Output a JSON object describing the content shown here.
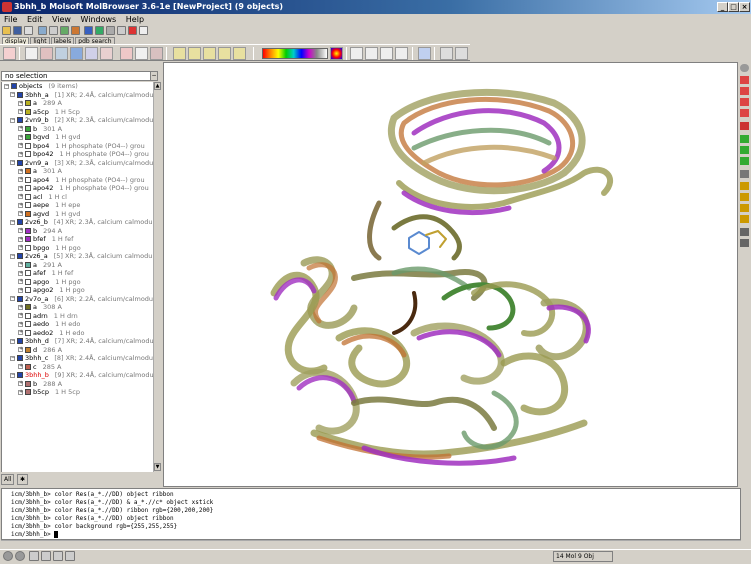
{
  "window": {
    "title": "3bhh_b Molsoft MolBrowser 3.6-1e  [NewProject]  (9 objects)"
  },
  "menu": [
    "File",
    "Edit",
    "View",
    "Windows",
    "Help"
  ],
  "toolbar_tabs": [
    "display",
    "light",
    "labels",
    "pdb search"
  ],
  "selection_label": "no selection",
  "tree": {
    "root": {
      "name": "objects",
      "desc": "(9 items)"
    },
    "rows": [
      {
        "level": 1,
        "name": "3bhh_a",
        "desc": "[1] XR; 2.4Å, calcium/calmodu",
        "chip": "#2244aa",
        "red": false
      },
      {
        "level": 2,
        "name": "a",
        "desc": "289 A",
        "chip": "#b8b020",
        "red": false
      },
      {
        "level": 2,
        "name": "a5cp",
        "desc": "1 H   5cp",
        "chip": "#b8b020",
        "red": false
      },
      {
        "level": 1,
        "name": "2vn9_b",
        "desc": "[2] XR; 2.3Å, calcium/calmodu",
        "chip": "#2244aa",
        "red": false
      },
      {
        "level": 2,
        "name": "b",
        "desc": "301 A",
        "chip": "#3aa63a",
        "red": false
      },
      {
        "level": 2,
        "name": "bgvd",
        "desc": "1 H   gvd",
        "chip": "#3aa63a",
        "red": false
      },
      {
        "level": 2,
        "name": "bpo4",
        "desc": "1 H   phosphate (PO4--) grou",
        "chip": "",
        "red": false
      },
      {
        "level": 2,
        "name": "bpo42",
        "desc": "1 H   phosphate (PO4--) grou",
        "chip": "",
        "red": false
      },
      {
        "level": 1,
        "name": "2vn9_a",
        "desc": "[3] XR; 2.3Å, calcium/calmodu",
        "chip": "#2244aa",
        "red": false
      },
      {
        "level": 2,
        "name": "a",
        "desc": "301 A",
        "chip": "#d07020",
        "red": false
      },
      {
        "level": 2,
        "name": "apo4",
        "desc": "1 H   phosphate (PO4--) grou",
        "chip": "",
        "red": false
      },
      {
        "level": 2,
        "name": "apo42",
        "desc": "1 H   phosphate (PO4--) grou",
        "chip": "",
        "red": false
      },
      {
        "level": 2,
        "name": "acl",
        "desc": "1 H   cl",
        "chip": "",
        "red": false
      },
      {
        "level": 2,
        "name": "aepe",
        "desc": "1 H   epe",
        "chip": "",
        "red": false
      },
      {
        "level": 2,
        "name": "agvd",
        "desc": "1 H   gvd",
        "chip": "#d07020",
        "red": false
      },
      {
        "level": 1,
        "name": "2vz6_b",
        "desc": "[4] XR; 2.3Å, calcium calmodu",
        "chip": "#2244aa",
        "red": false
      },
      {
        "level": 2,
        "name": "b",
        "desc": "294 A",
        "chip": "#a030c0",
        "red": false
      },
      {
        "level": 2,
        "name": "bfef",
        "desc": "1 H   fef",
        "chip": "#a030c0",
        "red": false
      },
      {
        "level": 2,
        "name": "bpgo",
        "desc": "1 H   pgo",
        "chip": "",
        "red": false
      },
      {
        "level": 1,
        "name": "2vz6_a",
        "desc": "[5] XR; 2.3Å, calcium calmodu",
        "chip": "#2244aa",
        "red": false
      },
      {
        "level": 2,
        "name": "a",
        "desc": "291 A",
        "chip": "#60b0a0",
        "red": false
      },
      {
        "level": 2,
        "name": "afef",
        "desc": "1 H   fef",
        "chip": "",
        "red": false
      },
      {
        "level": 2,
        "name": "apgo",
        "desc": "1 H   pgo",
        "chip": "",
        "red": false
      },
      {
        "level": 2,
        "name": "apgo2",
        "desc": "1 H   pgo",
        "chip": "",
        "red": false
      },
      {
        "level": 1,
        "name": "2v7o_a",
        "desc": "[6] XR; 2.2Å, calcium/calmodu",
        "chip": "#2244aa",
        "red": false
      },
      {
        "level": 2,
        "name": "a",
        "desc": "308 A",
        "chip": "#707020",
        "red": false
      },
      {
        "level": 2,
        "name": "adrn",
        "desc": "1 H   drn",
        "chip": "",
        "red": false
      },
      {
        "level": 2,
        "name": "aedo",
        "desc": "1 H   edo",
        "chip": "",
        "red": false
      },
      {
        "level": 2,
        "name": "aedo2",
        "desc": "1 H   edo",
        "chip": "",
        "red": false
      },
      {
        "level": 1,
        "name": "3bhh_d",
        "desc": "[7] XR; 2.4Å, calcium/calmodu",
        "chip": "#2244aa",
        "red": false
      },
      {
        "level": 2,
        "name": "d",
        "desc": "286 A",
        "chip": "#c08030",
        "red": false
      },
      {
        "level": 1,
        "name": "3bhh_c",
        "desc": "[8] XR; 2.4Å, calcium/calmodu",
        "chip": "#2244aa",
        "red": false
      },
      {
        "level": 2,
        "name": "c",
        "desc": "285 A",
        "chip": "#c06050",
        "red": false
      },
      {
        "level": 1,
        "name": "3bhh_b",
        "desc": "[9] XR; 2.4Å, calcium/calmodu",
        "chip": "#2244aa",
        "red": true
      },
      {
        "level": 2,
        "name": "b",
        "desc": "288 A",
        "chip": "#b07070",
        "red": false
      },
      {
        "level": 2,
        "name": "b5cp",
        "desc": "1 H   5cp",
        "chip": "#b07070",
        "red": false
      }
    ]
  },
  "left_tabs": [
    "All",
    "icon"
  ],
  "terminal": {
    "lines": [
      "icm/3bhh_b> color Res(a_*.//DD) object ribbon",
      "icm/3bhh_b> color Res(a_*.//DD) & a_*.//c* object xstick",
      "icm/3bhh_b> color Res(a_*.//DD) ribbon rgb={200,200,200}",
      "icm/3bhh_b> color Res(a_*.//DD) object ribbon",
      "icm/3bhh_b> color background rgb={255,255,255}",
      "icm/3bhh_b> "
    ]
  },
  "status": {
    "text": "14 Mol 9 Obj"
  },
  "colors": {
    "title_start": "#0a246a",
    "title_end": "#a6caf0",
    "selected_red": "#d00"
  }
}
